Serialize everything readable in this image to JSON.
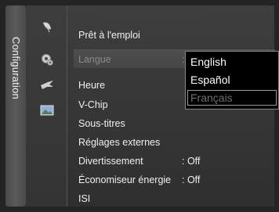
{
  "sidebar": {
    "title": "Configuration"
  },
  "icons": [
    "satellite-dish-icon",
    "gear-icon",
    "swallow-icon",
    "picture-icon"
  ],
  "menu": {
    "items": [
      {
        "label": "Prêt à l'emploi",
        "value": "",
        "dim": false
      },
      {
        "label": "Langue",
        "value": ":",
        "dim": true
      },
      {
        "label": "Heure",
        "value": "",
        "dim": false
      },
      {
        "label": "V-Chip",
        "value": "",
        "dim": false
      },
      {
        "label": "Sous-titres",
        "value": "",
        "dim": false
      },
      {
        "label": "Réglages externes",
        "value": "",
        "dim": false
      },
      {
        "label": "Divertissement",
        "value": ": Off",
        "dim": false
      },
      {
        "label": "Économiseur énergie",
        "value": ": Off",
        "dim": false
      },
      {
        "label": "ISI",
        "value": "",
        "dim": false
      }
    ]
  },
  "language_popup": {
    "options": [
      "English",
      "Español",
      "Français"
    ],
    "selected_index": 2
  }
}
